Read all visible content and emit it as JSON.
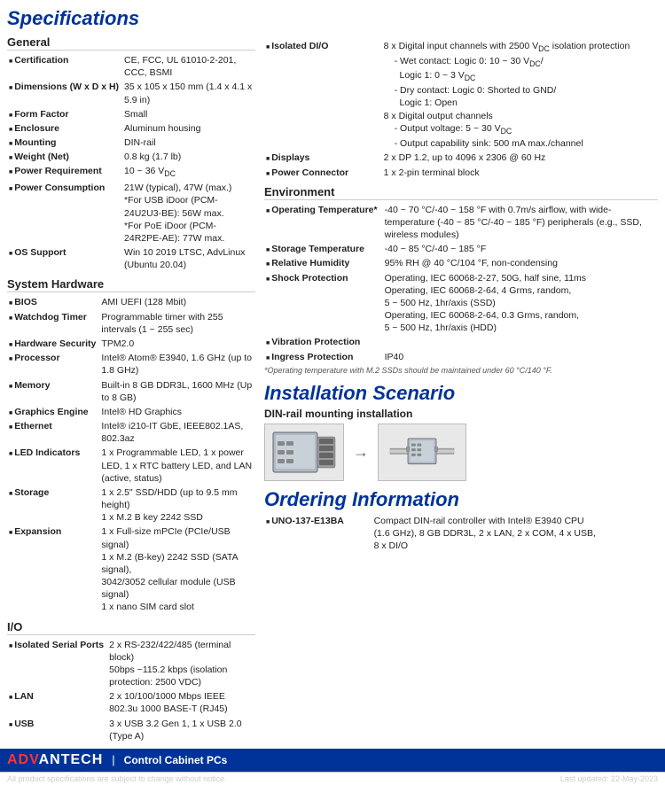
{
  "page": {
    "title": "Specifications",
    "install_title": "Installation Scenario",
    "order_title": "Ordering Information"
  },
  "left": {
    "general": {
      "heading": "General",
      "rows": [
        {
          "label": "Certification",
          "value": "CE, FCC, UL 61010-2-201, CCC, BSMI"
        },
        {
          "label": "Dimensions (W x D x H)",
          "value": "35 x 105 x 150 mm (1.4 x 4.1 x 5.9 in)"
        },
        {
          "label": "Form Factor",
          "value": "Small"
        },
        {
          "label": "Enclosure",
          "value": "Aluminum housing"
        },
        {
          "label": "Mounting",
          "value": "DIN-rail"
        },
        {
          "label": "Weight (Net)",
          "value": "0.8 kg (1.7 lb)"
        },
        {
          "label": "Power Requirement",
          "value": "10 ~ 36 VDC"
        },
        {
          "label": "Power Consumption",
          "value": "21W (typical), 47W (max.)\n*For USB iDoor (PCM-24U2U3-BE): 56W max.\n*For PoE iDoor (PCM-24R2PE-AE): 77W max."
        },
        {
          "label": "OS Support",
          "value": "Win 10 2019 LTSC, AdvLinux (Ubuntu 20.04)"
        }
      ]
    },
    "system": {
      "heading": "System Hardware",
      "rows": [
        {
          "label": "BIOS",
          "value": "AMI UEFI (128 Mbit)"
        },
        {
          "label": "Watchdog Timer",
          "value": "Programmable timer with 255 intervals (1 ~ 255 sec)"
        },
        {
          "label": "Hardware Security",
          "value": "TPM2.0"
        },
        {
          "label": "Processor",
          "value": "Intel® Atom® E3940, 1.6 GHz (up to 1.8 GHz)"
        },
        {
          "label": "Memory",
          "value": "Built-in 8 GB DDR3L, 1600 MHz (Up to 8 GB)"
        },
        {
          "label": "Graphics Engine",
          "value": "Intel® HD Graphics"
        },
        {
          "label": "Ethernet",
          "value": "Intel® i210-IT GbE, IEEE802.1AS, 802.3az"
        },
        {
          "label": "LED Indicators",
          "value": "1 x Programmable LED, 1 x power LED, 1 x RTC battery\nLED, and LAN (active, status)"
        },
        {
          "label": "Storage",
          "value": "1 x 2.5\" SSD/HDD (up to 9.5 mm height)\n1 x M.2 B key 2242 SSD"
        },
        {
          "label": "Expansion",
          "value": "1 x Full-size mPCIe (PCIe/USB signal)\n1 x M.2 (B-key) 2242 SSD (SATA signal),\n3042/3052 cellular module (USB signal)\n1 x nano SIM card slot"
        }
      ]
    },
    "io": {
      "heading": "I/O",
      "rows": [
        {
          "label": "Isolated Serial Ports",
          "value": "2 x RS-232/422/485 (terminal block)\n50bps ~115.2 kbps (isolation protection: 2500 VDC)"
        },
        {
          "label": "LAN",
          "value": "2 x 10/100/1000 Mbps IEEE 802.3u 1000 BASE-T (RJ45)"
        },
        {
          "label": "USB",
          "value": "3 x USB 3.2 Gen 1, 1 x USB 2.0 (Type A)"
        }
      ]
    }
  },
  "right": {
    "io_cont": {
      "rows": [
        {
          "label": "Isolated DI/O",
          "value": "8 x Digital input channels with 2500 VDC isolation protection",
          "subs": [
            "- Wet contact: Logic 0: 10 ~ 30 VDC/",
            "  Logic 1: 0 ~ 3 VDC",
            "- Dry contact: Logic 0: Shorted to GND/",
            "  Logic 1: Open",
            "8 x Digital output channels",
            "- Output voltage: 5 ~ 30 VDC",
            "- Output capability sink: 500 mA max./channel"
          ]
        },
        {
          "label": "Displays",
          "value": "2 x DP 1.2, up to 4096 x 2306 @ 60 Hz"
        },
        {
          "label": "Power Connector",
          "value": "1 x 2-pin terminal block"
        }
      ]
    },
    "environment": {
      "heading": "Environment",
      "rows": [
        {
          "label": "Operating Temperature*",
          "value": "-40 ~ 70 °C/-40 ~ 158 °F with 0.7m/s airflow, with wide-temperature (-40 ~ 85 °C/-40 ~ 185 °F) peripherals (e.g., SSD, wireless modules)"
        },
        {
          "label": "Storage Temperature",
          "value": "-40 ~ 85 °C/-40 ~ 185 °F"
        },
        {
          "label": "Relative Humidity",
          "value": "95% RH @ 40 °C/104 °F, non-condensing"
        },
        {
          "label": "Shock Protection",
          "value": "Operating, IEC 60068-2-27, 50G, half sine, 11ms\nOperating, IEC 60068-2-64, 4 Grms, random,\n5 ~ 500 Hz, 1hr/axis (SSD)\nOperating, IEC 60068-2-64, 0.3 Grms, random,\n5 ~ 500 Hz, 1hr/axis (HDD)"
        },
        {
          "label": "Vibration Protection",
          "value": ""
        },
        {
          "label": "Ingress Protection",
          "value": "IP40"
        }
      ]
    },
    "env_note": "*Operating temperature with M.2 SSDs should be maintained under 60 °C/140 °F.",
    "install": {
      "heading": "Installation Scenario",
      "sub": "DIN-rail mounting installation"
    },
    "ordering": {
      "heading": "Ordering Information",
      "rows": [
        {
          "label": "UNO-137-E13BA",
          "value": "Compact DIN-rail controller with Intel® E3940 CPU\n(1.6 GHz), 8 GB DDR3L, 2 x LAN, 2 x COM, 4 x USB,\n8 x DI/O"
        }
      ]
    }
  },
  "footer": {
    "logo_adv": "ADV",
    "logo_rest": "ANTECH",
    "product": "Control Cabinet PCs",
    "note_left": "All product specifications are subject to change without notice.",
    "note_right": "Last updated: 22-May-2023"
  }
}
